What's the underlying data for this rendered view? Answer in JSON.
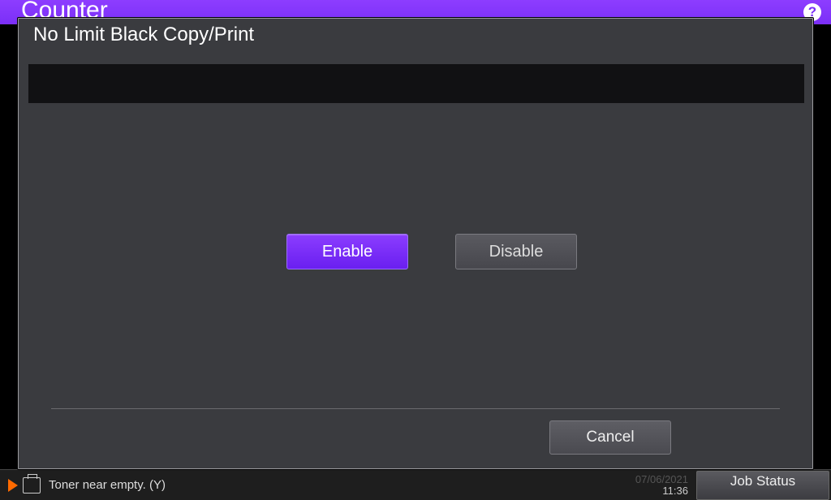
{
  "header": {
    "title": "Counter",
    "help_glyph": "?"
  },
  "dialog": {
    "title": "No Limit Black Copy/Print",
    "enable_label": "Enable",
    "disable_label": "Disable",
    "cancel_label": "Cancel"
  },
  "status": {
    "toner_msg": "Toner near empty. (Y)",
    "date": "07/06/2021",
    "time": "11:36",
    "job_status_label": "Job Status"
  }
}
